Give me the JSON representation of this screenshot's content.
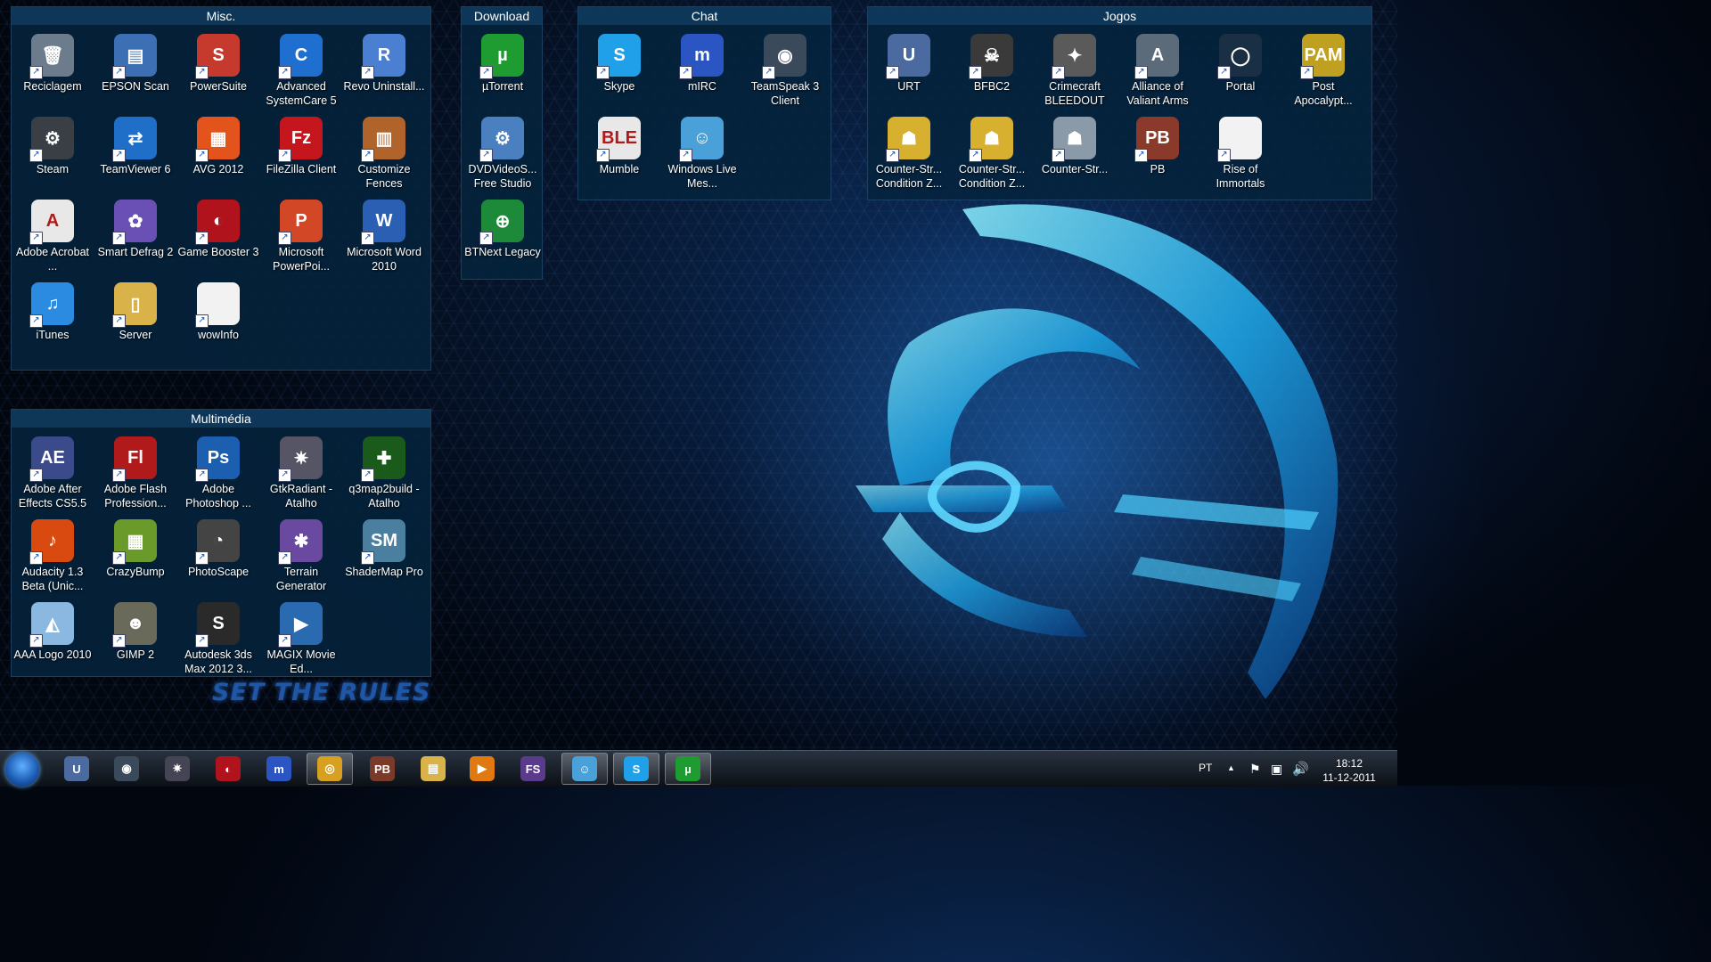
{
  "desktop": {
    "slogan": "SET THE RULES",
    "fences": [
      {
        "title": "Misc.",
        "icons": [
          {
            "label": "Reciclagem",
            "icon": "recycle-bin-icon",
            "color": "#6c7c8c",
            "glyph": "🗑"
          },
          {
            "label": "EPSON Scan",
            "icon": "scanner-icon",
            "color": "#3d6fb5",
            "glyph": "▤"
          },
          {
            "label": "PowerSuite",
            "icon": "powersuite-icon",
            "color": "#c53a2d",
            "glyph": "S"
          },
          {
            "label": "Advanced SystemCare 5",
            "icon": "systemcare-icon",
            "color": "#1e6fd0",
            "glyph": "C"
          },
          {
            "label": "Revo Uninstall...",
            "icon": "revo-icon",
            "color": "#4b7fd1",
            "glyph": "R"
          },
          {
            "label": "Steam",
            "icon": "steam-icon",
            "color": "#3a3f46",
            "glyph": "⚙"
          },
          {
            "label": "TeamViewer 6",
            "icon": "teamviewer-icon",
            "color": "#1f6fc9",
            "glyph": "⇄"
          },
          {
            "label": "AVG 2012",
            "icon": "avg-icon",
            "color": "#e3541c",
            "glyph": "▦"
          },
          {
            "label": "FileZilla Client",
            "icon": "filezilla-icon",
            "color": "#c4161c",
            "glyph": "Fz"
          },
          {
            "label": "Customize Fences",
            "icon": "fences-icon",
            "color": "#b0632a",
            "glyph": "▥"
          },
          {
            "label": "Adobe Acrobat ...",
            "icon": "acrobat-icon",
            "color": "#e8e8e8",
            "glyph": "A"
          },
          {
            "label": "Smart Defrag 2",
            "icon": "defrag-icon",
            "color": "#6a4fb5",
            "glyph": "✿"
          },
          {
            "label": "Game Booster 3",
            "icon": "gamebooster-icon",
            "color": "#b0131b",
            "glyph": "◐"
          },
          {
            "label": "Microsoft PowerPoi...",
            "icon": "powerpoint-icon",
            "color": "#d24726",
            "glyph": "P"
          },
          {
            "label": "Microsoft Word 2010",
            "icon": "word-icon",
            "color": "#2b5fb3",
            "glyph": "W"
          },
          {
            "label": "iTunes",
            "icon": "itunes-icon",
            "color": "#2a8be0",
            "glyph": "♫"
          },
          {
            "label": "Server",
            "icon": "folder-icon",
            "color": "#d9b24a",
            "glyph": "▯"
          },
          {
            "label": "wowInfo",
            "icon": "file-icon",
            "color": "#f2f2f2",
            "glyph": ""
          }
        ]
      },
      {
        "title": "Download",
        "icons": [
          {
            "label": "µTorrent",
            "icon": "utorrent-icon",
            "color": "#1e9c32",
            "glyph": "µ"
          },
          {
            "label": "DVDVideoS... Free Studio",
            "icon": "dvdvideosoft-icon",
            "color": "#4a7fc0",
            "glyph": "⚙"
          },
          {
            "label": "BTNext Legacy",
            "icon": "btnext-icon",
            "color": "#1d8a3a",
            "glyph": "⊕"
          }
        ]
      },
      {
        "title": "Chat",
        "icons": [
          {
            "label": "Skype",
            "icon": "skype-icon",
            "color": "#1fa0e8",
            "glyph": "S"
          },
          {
            "label": "mIRC",
            "icon": "mirc-icon",
            "color": "#2b55c2",
            "glyph": "m"
          },
          {
            "label": "TeamSpeak 3 Client",
            "icon": "teamspeak-icon",
            "color": "#3a4a5a",
            "glyph": "◉"
          },
          {
            "label": "Mumble",
            "icon": "mumble-icon",
            "color": "#e8e8e8",
            "glyph": "BLE"
          },
          {
            "label": "Windows Live Mes...",
            "icon": "messenger-icon",
            "color": "#4aa0d8",
            "glyph": "☺"
          }
        ]
      },
      {
        "title": "Jogos",
        "icons": [
          {
            "label": "URT",
            "icon": "urt-icon",
            "color": "#4a6aa0",
            "glyph": "U"
          },
          {
            "label": "BFBC2",
            "icon": "bfbc2-icon",
            "color": "#3a3a3a",
            "glyph": "☠"
          },
          {
            "label": "Crimecraft BLEEDOUT",
            "icon": "crimecraft-icon",
            "color": "#5a5a5a",
            "glyph": "✦"
          },
          {
            "label": "Alliance of Valiant Arms",
            "icon": "ava-icon",
            "color": "#5b6b7a",
            "glyph": "A"
          },
          {
            "label": "Portal",
            "icon": "portal-icon",
            "color": "#1a2e44",
            "glyph": "◯"
          },
          {
            "label": "Post Apocalypt...",
            "icon": "pam-icon",
            "color": "#c0a020",
            "glyph": "PAM"
          },
          {
            "label": "Counter-Str... Condition Z...",
            "icon": "cs-czero-icon",
            "color": "#d8b030",
            "glyph": "☗"
          },
          {
            "label": "Counter-Str... Condition Z...",
            "icon": "cs-czero-icon",
            "color": "#d8b030",
            "glyph": "☗"
          },
          {
            "label": "Counter-Str...",
            "icon": "cs-icon",
            "color": "#8a9aa8",
            "glyph": "☗"
          },
          {
            "label": "PB",
            "icon": "pb-icon",
            "color": "#8a3a2a",
            "glyph": "PB"
          },
          {
            "label": "Rise of Immortals",
            "icon": "file-icon",
            "color": "#f2f2f2",
            "glyph": ""
          }
        ]
      },
      {
        "title": "Multimédia",
        "icons": [
          {
            "label": "Adobe After Effects CS5.5",
            "icon": "aftereffects-icon",
            "color": "#3a4a8a",
            "glyph": "AE"
          },
          {
            "label": "Adobe Flash Profession...",
            "icon": "flash-icon",
            "color": "#b01a1a",
            "glyph": "Fl"
          },
          {
            "label": "Adobe Photoshop ...",
            "icon": "photoshop-icon",
            "color": "#1c5fb0",
            "glyph": "Ps"
          },
          {
            "label": "GtkRadiant - Atalho",
            "icon": "gtkradiant-icon",
            "color": "#556",
            "glyph": "✷"
          },
          {
            "label": "q3map2build - Atalho",
            "icon": "q3map2-icon",
            "color": "#1a5a1a",
            "glyph": "✚"
          },
          {
            "label": "Audacity 1.3 Beta (Unic...",
            "icon": "audacity-icon",
            "color": "#d84a10",
            "glyph": "♪"
          },
          {
            "label": "CrazyBump",
            "icon": "crazybump-icon",
            "color": "#6a9a2a",
            "glyph": "▦"
          },
          {
            "label": "PhotoScape",
            "icon": "photoscape-icon",
            "color": "#444",
            "glyph": "◔"
          },
          {
            "label": "Terrain Generator",
            "icon": "terrain-icon",
            "color": "#6a4aa0",
            "glyph": "✱"
          },
          {
            "label": "ShaderMap Pro",
            "icon": "shadermap-icon",
            "color": "#4a7fa0",
            "glyph": "SM"
          },
          {
            "label": "AAA Logo 2010",
            "icon": "aaalogo-icon",
            "color": "#8ab8e0",
            "glyph": "◭"
          },
          {
            "label": "GIMP 2",
            "icon": "gimp-icon",
            "color": "#6a6a5a",
            "glyph": "☻"
          },
          {
            "label": "Autodesk 3ds Max 2012 3...",
            "icon": "3dsmax-icon",
            "color": "#2a2a2a",
            "glyph": "S"
          },
          {
            "label": "MAGIX Movie Ed...",
            "icon": "magix-icon",
            "color": "#2a6ab0",
            "glyph": "▶"
          }
        ]
      }
    ]
  },
  "taskbar": {
    "items": [
      {
        "name": "urt-taskbar-icon",
        "glyph": "U",
        "color": "#4a6aa0",
        "active": false
      },
      {
        "name": "teamspeak-taskbar-icon",
        "glyph": "◉",
        "color": "#3a4a5a",
        "active": false
      },
      {
        "name": "gtkradiant-taskbar-icon",
        "glyph": "✷",
        "color": "#445",
        "active": false
      },
      {
        "name": "gamebooster-taskbar-icon",
        "glyph": "◐",
        "color": "#b0131b",
        "active": false
      },
      {
        "name": "mirc-taskbar-icon",
        "glyph": "m",
        "color": "#2b55c2",
        "active": false
      },
      {
        "name": "chrome-taskbar-icon",
        "glyph": "◎",
        "color": "#d8a020",
        "active": true
      },
      {
        "name": "pb-taskbar-icon",
        "glyph": "PB",
        "color": "#7a3a2a",
        "active": false
      },
      {
        "name": "explorer-taskbar-icon",
        "glyph": "▤",
        "color": "#d9b24a",
        "active": false
      },
      {
        "name": "media-player-taskbar-icon",
        "glyph": "▶",
        "color": "#e07a10",
        "active": false
      },
      {
        "name": "fs-taskbar-icon",
        "glyph": "FS",
        "color": "#5a3a8a",
        "active": false
      },
      {
        "name": "messenger-taskbar-icon",
        "glyph": "☺",
        "color": "#4aa0d8",
        "active": true
      },
      {
        "name": "skype-taskbar-icon",
        "glyph": "S",
        "color": "#1fa0e8",
        "active": true
      },
      {
        "name": "utorrent-taskbar-icon",
        "glyph": "µ",
        "color": "#1e9c32",
        "active": true
      }
    ],
    "language": "PT",
    "tray_arrow": "▲",
    "clock_time": "18:12",
    "clock_date": "11-12-2011"
  }
}
